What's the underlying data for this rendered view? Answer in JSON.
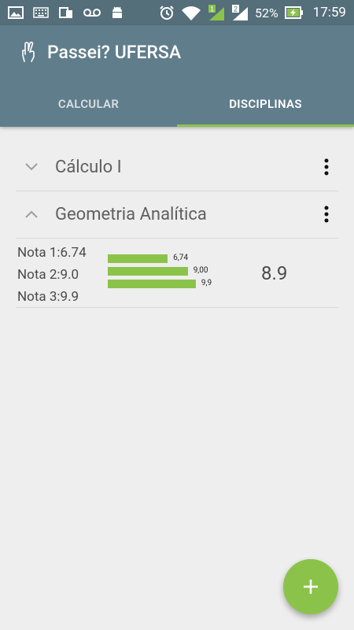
{
  "status_bar": {
    "battery": "52%",
    "time": "17:59",
    "sim1_badge": "1",
    "sim2_badge": "2",
    "icons_left": [
      "image-icon",
      "keyboard-icon",
      "devices-icon",
      "voicemail-icon",
      "android-icon"
    ],
    "icons_right": [
      "alarm-icon",
      "wifi-icon",
      "signal-1-icon",
      "signal-2-icon",
      "battery-charging-icon"
    ]
  },
  "app_bar": {
    "title": "Passei? UFERSA",
    "logo_icon": "crossed-fingers-icon",
    "tabs": [
      {
        "label": "CALCULAR",
        "active": false
      },
      {
        "label": "DISCIPLINAS",
        "active": true
      }
    ]
  },
  "subjects": [
    {
      "name": "Cálculo I",
      "expanded": false
    },
    {
      "name": "Geometria Analítica",
      "expanded": true
    }
  ],
  "grades": {
    "labels": [
      "Nota 1:6.74",
      "Nota 2:9.0",
      "Nota 3:9.9"
    ],
    "values": [
      6.74,
      9.0,
      9.9
    ],
    "bar_labels": [
      "6,74",
      "9,00",
      "9,9"
    ],
    "average": "8.9"
  },
  "fab": {
    "label": "+",
    "icon": "add-icon"
  },
  "colors": {
    "primary": "#607d8b",
    "primary_dark": "#546e7a",
    "accent": "#8bc34a",
    "background": "#eeeeee"
  }
}
